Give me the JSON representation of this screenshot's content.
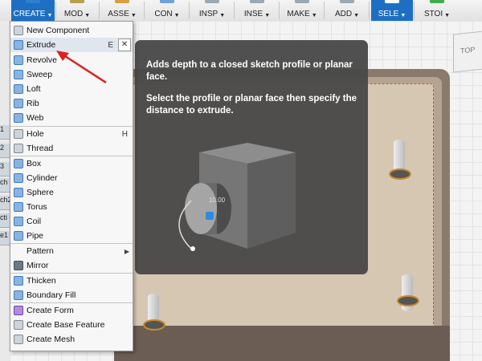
{
  "toolbar": {
    "items": [
      {
        "label": "CREATE",
        "color": "#2d7fd0"
      },
      {
        "label": "MOD",
        "color": "#b7a04a"
      },
      {
        "label": "ASSE",
        "color": "#d6a040"
      },
      {
        "label": "CON",
        "color": "#6aa4d8"
      },
      {
        "label": "INSP",
        "color": "#9aa9b5"
      },
      {
        "label": "INSE",
        "color": "#9aa9b5"
      },
      {
        "label": "MAKE",
        "color": "#9aa9b5"
      },
      {
        "label": "ADD",
        "color": "#9aa9b5"
      },
      {
        "label": "SELE",
        "color": "#ffffff"
      },
      {
        "label": "STOI",
        "color": "#3fae4a"
      }
    ]
  },
  "left_tabs": [
    "1",
    "2",
    "3",
    "ch",
    "ch2",
    "cti",
    "e1"
  ],
  "menu": {
    "items": [
      {
        "label": "New Component",
        "icon": "new-component-icon",
        "icls": "c-grey",
        "shortcut": ""
      },
      {
        "label": "Extrude",
        "icon": "extrude-icon",
        "icls": "c-blue",
        "shortcut": "E",
        "highlight": true
      },
      {
        "label": "Revolve",
        "icon": "revolve-icon",
        "icls": "c-blue",
        "shortcut": ""
      },
      {
        "label": "Sweep",
        "icon": "sweep-icon",
        "icls": "c-blue",
        "shortcut": ""
      },
      {
        "label": "Loft",
        "icon": "loft-icon",
        "icls": "c-blue",
        "shortcut": ""
      },
      {
        "label": "Rib",
        "icon": "rib-icon",
        "icls": "c-blue",
        "shortcut": ""
      },
      {
        "label": "Web",
        "icon": "web-icon",
        "icls": "c-blue",
        "shortcut": ""
      },
      {
        "label": "Hole",
        "icon": "hole-icon",
        "icls": "c-grey",
        "shortcut": "H"
      },
      {
        "label": "Thread",
        "icon": "thread-icon",
        "icls": "c-grey",
        "shortcut": ""
      },
      {
        "label": "Box",
        "icon": "box-icon",
        "icls": "c-blue",
        "shortcut": ""
      },
      {
        "label": "Cylinder",
        "icon": "cylinder-icon",
        "icls": "c-blue",
        "shortcut": ""
      },
      {
        "label": "Sphere",
        "icon": "sphere-icon",
        "icls": "c-blue",
        "shortcut": ""
      },
      {
        "label": "Torus",
        "icon": "torus-icon",
        "icls": "c-blue",
        "shortcut": ""
      },
      {
        "label": "Coil",
        "icon": "coil-icon",
        "icls": "c-blue",
        "shortcut": ""
      },
      {
        "label": "Pipe",
        "icon": "pipe-icon",
        "icls": "c-blue",
        "shortcut": ""
      },
      {
        "label": "Pattern",
        "icon": "",
        "icls": "",
        "shortcut": "",
        "submenu": true
      },
      {
        "label": "Mirror",
        "icon": "mirror-icon",
        "icls": "c-dark",
        "shortcut": ""
      },
      {
        "label": "Thicken",
        "icon": "thicken-icon",
        "icls": "c-blue",
        "shortcut": ""
      },
      {
        "label": "Boundary Fill",
        "icon": "boundary-fill-icon",
        "icls": "c-blue",
        "shortcut": ""
      },
      {
        "label": "Create Form",
        "icon": "create-form-icon",
        "icls": "c-purple",
        "shortcut": ""
      },
      {
        "label": "Create Base Feature",
        "icon": "create-base-feature-icon",
        "icls": "c-grey",
        "shortcut": ""
      },
      {
        "label": "Create Mesh",
        "icon": "create-mesh-icon",
        "icls": "c-grey",
        "shortcut": ""
      }
    ],
    "close_label": "✕"
  },
  "tooltip": {
    "line1": "Adds depth to a closed sketch profile or planar face.",
    "line2": "Select the profile or planar face then specify the distance to extrude.",
    "dim_value": "10.00"
  },
  "viewcube": {
    "label": "TOP"
  },
  "annotation_color": "#e02020"
}
